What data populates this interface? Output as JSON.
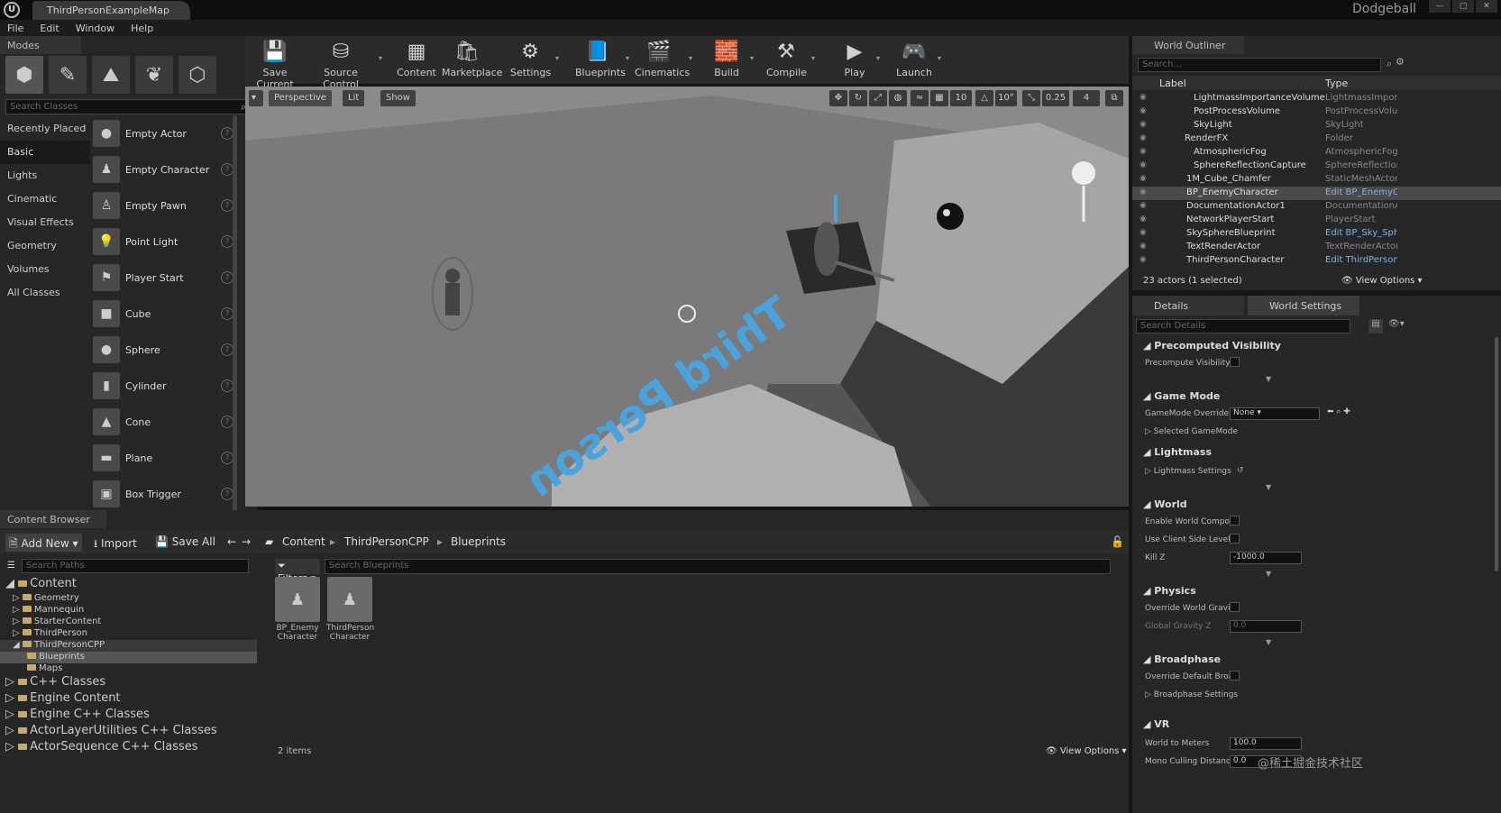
{
  "window": {
    "tab_title": "ThirdPersonExampleMap",
    "project": "Dodgeball",
    "controls": [
      "—",
      "▢",
      "✕"
    ]
  },
  "menu": [
    "File",
    "Edit",
    "Window",
    "Help"
  ],
  "modes": {
    "tab": "Modes",
    "search_placeholder": "Search Classes",
    "categories": [
      "Recently Placed",
      "Basic",
      "Lights",
      "Cinematic",
      "Visual Effects",
      "Geometry",
      "Volumes",
      "All Classes"
    ],
    "items": [
      "Empty Actor",
      "Empty Character",
      "Empty Pawn",
      "Point Light",
      "Player Start",
      "Cube",
      "Sphere",
      "Cylinder",
      "Cone",
      "Plane",
      "Box Trigger"
    ]
  },
  "toolbar": [
    {
      "label": "Save Current",
      "icon": "save-icon",
      "glyph": "💾"
    },
    {
      "label": "Source Control",
      "icon": "source-control-icon",
      "glyph": "⛁"
    },
    {
      "label": "Content",
      "icon": "content-icon",
      "glyph": "▦"
    },
    {
      "label": "Marketplace",
      "icon": "marketplace-icon",
      "glyph": "🛍"
    },
    {
      "label": "Settings",
      "icon": "settings-icon",
      "glyph": "⚙"
    },
    {
      "label": "Blueprints",
      "icon": "blueprints-icon",
      "glyph": "📘"
    },
    {
      "label": "Cinematics",
      "icon": "cinematics-icon",
      "glyph": "🎬"
    },
    {
      "label": "Build",
      "icon": "build-icon",
      "glyph": "🧱"
    },
    {
      "label": "Compile",
      "icon": "compile-icon",
      "glyph": "⚒"
    },
    {
      "label": "Play",
      "icon": "play-icon",
      "glyph": "▶"
    },
    {
      "label": "Launch",
      "icon": "launch-icon",
      "glyph": "🎮"
    }
  ],
  "viewport": {
    "perspective": "Perspective",
    "lit": "Lit",
    "show": "Show",
    "grid_snap": "10",
    "rot_snap": "10°",
    "scale_snap": "0.25",
    "cam_speed": "4",
    "floor_text": "Third Person"
  },
  "content_browser": {
    "tab": "Content Browser",
    "add_new": "Add New",
    "import": "Import",
    "save_all": "Save All",
    "breadcrumb": [
      "Content",
      "ThirdPersonCPP",
      "Blueprints"
    ],
    "paths_placeholder": "Search Paths",
    "filters": "Filters",
    "search_placeholder": "Search Blueprints",
    "tree": [
      {
        "label": "Content",
        "big": true
      },
      {
        "label": "Geometry"
      },
      {
        "label": "Mannequin"
      },
      {
        "label": "StarterContent"
      },
      {
        "label": "ThirdPerson"
      },
      {
        "label": "ThirdPersonCPP"
      },
      {
        "label": "Blueprints"
      },
      {
        "label": "Maps"
      },
      {
        "label": "C++ Classes",
        "big": true
      },
      {
        "label": "Engine Content",
        "big": true
      },
      {
        "label": "Engine C++ Classes",
        "big": true
      },
      {
        "label": "ActorLayerUtilities C++ Classes",
        "big": true
      },
      {
        "label": "ActorSequence C++ Classes",
        "big": true
      }
    ],
    "assets": [
      {
        "line1": "BP_Enemy",
        "line2": "Character"
      },
      {
        "line1": "ThirdPerson",
        "line2": "Character"
      }
    ],
    "item_count": "2 items",
    "view_options": "View Options"
  },
  "world_outliner": {
    "tab": "World Outliner",
    "search_placeholder": "Search...",
    "col_label": "Label",
    "col_type": "Type",
    "rows": [
      {
        "label": "LightmassImportanceVolume",
        "type": "LightmassImporta",
        "indent": 68
      },
      {
        "label": "PostProcessVolume",
        "type": "PostProcessVolum",
        "indent": 68
      },
      {
        "label": "SkyLight",
        "type": "SkyLight",
        "indent": 68
      },
      {
        "label": "RenderFX",
        "type": "Folder",
        "indent": 58
      },
      {
        "label": "AtmosphericFog",
        "type": "AtmosphericFog",
        "indent": 68
      },
      {
        "label": "SphereReflectionCapture",
        "type": "SphereReflectionC",
        "indent": 68
      },
      {
        "label": "1M_Cube_Chamfer",
        "type": "StaticMeshActor",
        "indent": 60
      },
      {
        "label": "BP_EnemyCharacter",
        "type": "Edit BP_EnemyC",
        "indent": 60,
        "link": true,
        "sel": true
      },
      {
        "label": "DocumentationActor1",
        "type": "DocumentationAc",
        "indent": 60
      },
      {
        "label": "NetworkPlayerStart",
        "type": "PlayerStart",
        "indent": 60
      },
      {
        "label": "SkySphereBlueprint",
        "type": "Edit BP_Sky_Sph",
        "indent": 60,
        "link": true
      },
      {
        "label": "TextRenderActor",
        "type": "TextRenderActor",
        "indent": 60
      },
      {
        "label": "ThirdPersonCharacter",
        "type": "Edit ThirdPerson",
        "indent": 60,
        "link": true
      }
    ],
    "status": "23 actors (1 selected)",
    "view_options": "View Options"
  },
  "details": {
    "tab_details": "Details",
    "tab_world": "World Settings",
    "search_placeholder": "Search Details",
    "sections": [
      {
        "title": "Precomputed Visibility",
        "props": [
          {
            "name": "Precompute Visibility",
            "kind": "check"
          }
        ]
      },
      {
        "title": "Game Mode",
        "props": [
          {
            "name": "GameMode Override",
            "kind": "select",
            "value": "None"
          },
          {
            "name": "Selected GameMode",
            "kind": "label"
          }
        ]
      },
      {
        "title": "Lightmass",
        "props": [
          {
            "name": "Lightmass Settings",
            "kind": "label"
          }
        ]
      },
      {
        "title": "World",
        "props": [
          {
            "name": "Enable World Composi",
            "kind": "check"
          },
          {
            "name": "Use Client Side Level",
            "kind": "check"
          },
          {
            "name": "Kill Z",
            "kind": "field",
            "value": "-1000.0"
          }
        ]
      },
      {
        "title": "Physics",
        "props": [
          {
            "name": "Override World Gravity",
            "kind": "check"
          },
          {
            "name": "Global Gravity Z",
            "kind": "field",
            "value": "0.0"
          }
        ]
      },
      {
        "title": "Broadphase",
        "props": [
          {
            "name": "Override Default Broa",
            "kind": "check"
          },
          {
            "name": "Broadphase Settings",
            "kind": "label"
          }
        ]
      },
      {
        "title": "VR",
        "props": [
          {
            "name": "World to Meters",
            "kind": "field",
            "value": "100.0"
          },
          {
            "name": "Mono Culling Distance",
            "kind": "field",
            "value": "0.0"
          }
        ]
      }
    ]
  },
  "watermark": "@稀土掘金技术社区"
}
